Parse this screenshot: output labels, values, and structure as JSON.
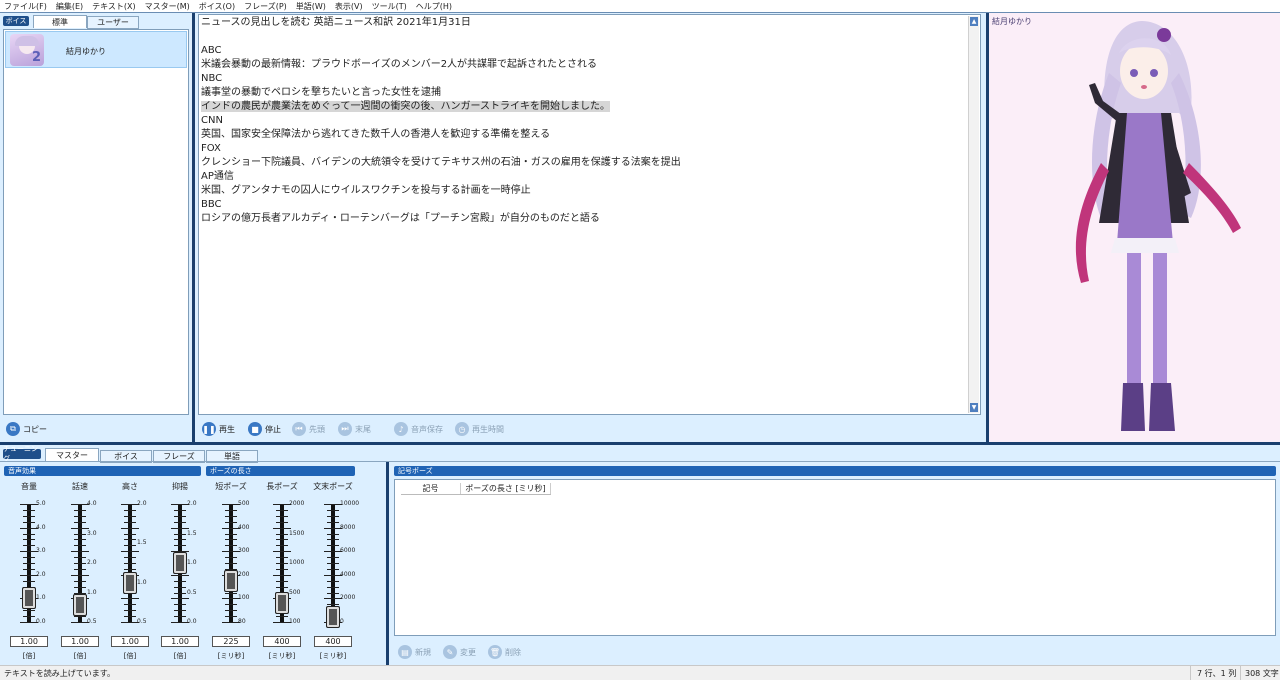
{
  "menu": [
    "ファイル(F)",
    "編集(E)",
    "テキスト(X)",
    "マスター(M)",
    "ボイス(O)",
    "フレーズ(P)",
    "単語(W)",
    "表示(V)",
    "ツール(T)",
    "ヘルプ(H)"
  ],
  "voice_panel": {
    "tag": "ボイス",
    "tabs": [
      "標準",
      "ユーザー"
    ],
    "voices": [
      {
        "name": "結月ゆかり",
        "badge": "2"
      }
    ],
    "copy_label": "コピー"
  },
  "editor": {
    "lines": [
      "ニュースの見出しを読む 英語ニュース和訳 2021年1月31日",
      "",
      "ABC",
      "米議会暴動の最新情報：プラウドボーイズのメンバー2人が共謀罪で起訴されたとされる",
      "NBC",
      "議事堂の暴動でペロシを撃ちたいと言った女性を逮捕",
      "インドの農民が農業法をめぐって一週間の衝突の後、ハンガーストライキを開始しました。",
      "CNN",
      "英国、国家安全保障法から逃れてきた数千人の香港人を歓迎する準備を整える",
      "FOX",
      "クレンショー下院議員、バイデンの大統領令を受けてテキサス州の石油・ガスの雇用を保護する法案を提出",
      "AP通信",
      "米国、グアンタナモの囚人にウイルスワクチンを投与する計画を一時停止",
      "BBC",
      "ロシアの億万長者アルカディ・ローテンバーグは「プーチン宮殿」が自分のものだと語る"
    ],
    "highlighted_line": 6
  },
  "playback": {
    "play": "再生",
    "stop": "停止",
    "first": "先頭",
    "last": "末尾",
    "save": "音声保存",
    "time": "再生時間"
  },
  "character": {
    "name": "結月ゆかり"
  },
  "tuning": {
    "tag": "チューニング",
    "tabs": [
      "マスター",
      "ボイス",
      "フレーズ",
      "単語"
    ],
    "active_tab": 0
  },
  "sections": {
    "effects": "音声効果",
    "pause_length": "ポーズの長さ",
    "symbol_pause": "記号ポーズ"
  },
  "sliders": [
    {
      "label": "音量",
      "ticks": [
        "5.0",
        "4.0",
        "3.0",
        "2.0",
        "1.0",
        "0.0"
      ],
      "min": 0,
      "max": 5,
      "value": "1.00",
      "num": 1.0,
      "unit": "[倍]"
    },
    {
      "label": "話速",
      "ticks": [
        "4.0",
        "3.0",
        "2.0",
        "1.0",
        "0.5"
      ],
      "min": 0.5,
      "max": 4,
      "value": "1.00",
      "num": 1.0,
      "unit": "[倍]"
    },
    {
      "label": "高さ",
      "ticks": [
        "2.0",
        "1.5",
        "1.0",
        "0.5"
      ],
      "min": 0.5,
      "max": 2,
      "value": "1.00",
      "num": 1.0,
      "unit": "[倍]"
    },
    {
      "label": "抑揚",
      "ticks": [
        "2.0",
        "1.5",
        "1.0",
        "0.5",
        "0.0"
      ],
      "min": 0,
      "max": 2,
      "value": "1.00",
      "num": 1.0,
      "unit": "[倍]"
    },
    {
      "label": "短ポーズ",
      "ticks": [
        "500",
        "400",
        "300",
        "200",
        "100",
        "80"
      ],
      "min": 80,
      "max": 500,
      "value": "225",
      "num": 225,
      "unit": "[ミリ秒]"
    },
    {
      "label": "長ポーズ",
      "ticks": [
        "2000",
        "1500",
        "1000",
        "500",
        "100"
      ],
      "min": 100,
      "max": 2000,
      "value": "400",
      "num": 400,
      "unit": "[ミリ秒]"
    },
    {
      "label": "文末ポーズ",
      "ticks": [
        "10000",
        "8000",
        "6000",
        "4000",
        "2000",
        "0"
      ],
      "min": 0,
      "max": 10000,
      "value": "400",
      "num": 400,
      "unit": "[ミリ秒]"
    }
  ],
  "symbol_table": {
    "headers": [
      "記号",
      "ポーズの長さ [ミリ秒]"
    ],
    "rows": []
  },
  "symbol_actions": {
    "new": "新規",
    "edit": "変更",
    "delete": "削除"
  },
  "status": {
    "message": "テキストを読み上げています。",
    "position": "7 行、1 列",
    "chars": "308 文字"
  },
  "colors": {
    "accent": "#1f63b5",
    "panel": "#dcefff",
    "divider": "#1a3f6e"
  }
}
